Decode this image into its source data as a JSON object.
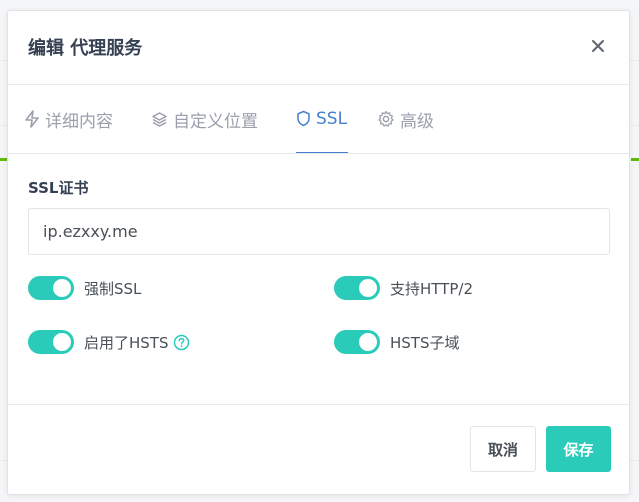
{
  "modal": {
    "title": "编辑 代理服务",
    "close_icon": "close-icon"
  },
  "tabs": [
    {
      "label": "详细内容",
      "icon": "bolt-icon",
      "active": false
    },
    {
      "label": "自定义位置",
      "icon": "layers-icon",
      "active": false
    },
    {
      "label": "SSL",
      "icon": "shield-icon",
      "active": true
    },
    {
      "label": "高级",
      "icon": "gear-icon",
      "active": false
    }
  ],
  "ssl": {
    "cert_label": "SSL证书",
    "cert_value": "ip.ezxxy.me",
    "toggles": [
      {
        "label": "强制SSL",
        "on": true
      },
      {
        "label": "支持HTTP/2",
        "on": true
      },
      {
        "label": "启用了HSTS",
        "on": true,
        "help_icon": "question-circle-icon"
      },
      {
        "label": "HSTS子域",
        "on": true
      }
    ]
  },
  "footer": {
    "cancel_label": "取消",
    "save_label": "保存"
  },
  "colors": {
    "accent": "#2bcbba",
    "tab_active": "#467fcf",
    "background_status": "#5eba00"
  }
}
